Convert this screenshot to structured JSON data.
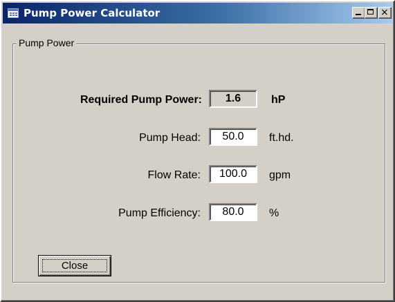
{
  "window": {
    "title": "Pump Power Calculator",
    "icon": "calculator-app-icon",
    "controls": {
      "minimize": "minimize-icon",
      "maximize": "maximize-icon",
      "close": "close-icon",
      "close_glyph": "×"
    }
  },
  "group": {
    "label": "Pump Power"
  },
  "result": {
    "label": "Required Pump Power:",
    "value": "1.6",
    "unit": "hP"
  },
  "inputs": [
    {
      "label": "Pump Head:",
      "value": "50.0",
      "unit": "ft.hd."
    },
    {
      "label": "Flow Rate:",
      "value": "100.0",
      "unit": "gpm"
    },
    {
      "label": "Pump Efficiency:",
      "value": "80.0",
      "unit": "%"
    }
  ],
  "buttons": {
    "close_label": "Close"
  },
  "colors": {
    "title_start": "#0a246a",
    "title_end": "#a6caf0",
    "face": "#d4d0c8"
  }
}
